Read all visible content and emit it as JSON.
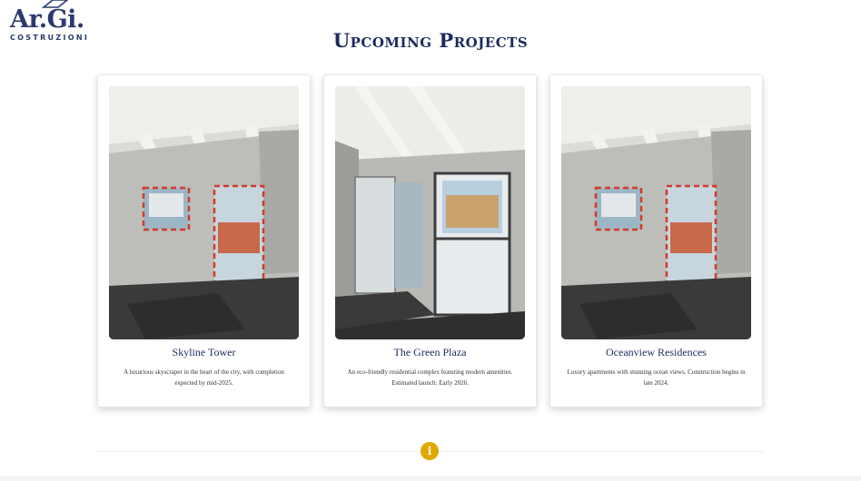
{
  "brand": {
    "name": "Ar.Gi.",
    "tagline": "COSTRUZIONI",
    "color": "#2a3a6e"
  },
  "section": {
    "title": "Upcoming Projects"
  },
  "projects": [
    {
      "title": "Skyline Tower",
      "description": "A luxurious skyscraper in the heart of the city, with completion expected by mid-2025.",
      "photo": "attic-room-interior"
    },
    {
      "title": "The Green Plaza",
      "description": "An eco-friendly residential complex featuring modern amenities. Estimated launch: Early 2026.",
      "photo": "room-with-glass-door"
    },
    {
      "title": "Oceanview Residences",
      "description": "Luxury apartments with stunning ocean views. Construction begins in late 2024.",
      "photo": "attic-room-interior"
    }
  ],
  "footer": {
    "info_icon": "i",
    "accent": "#e0a800"
  }
}
